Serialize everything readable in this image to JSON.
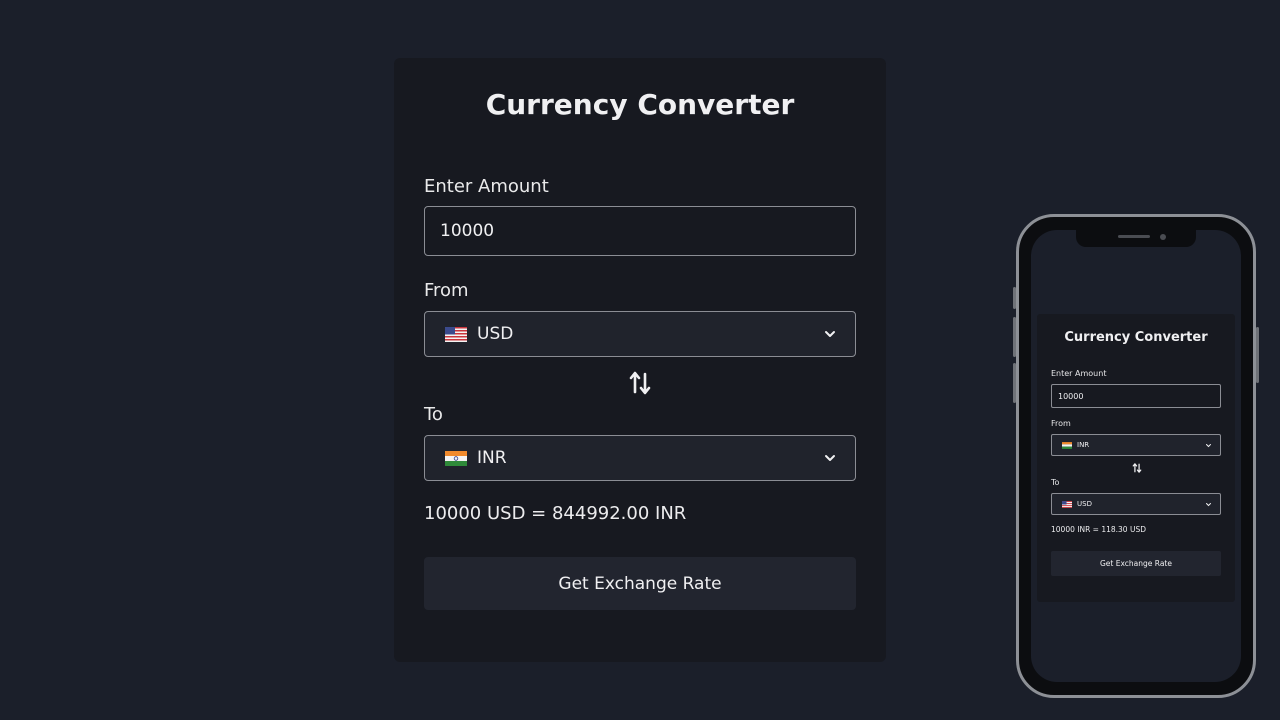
{
  "converter": {
    "title": "Currency Converter",
    "amount_label": "Enter Amount",
    "amount_value": "10000",
    "from_label": "From",
    "from_currency": {
      "code": "USD",
      "flag": "us-flag-icon"
    },
    "to_label": "To",
    "to_currency": {
      "code": "INR",
      "flag": "india-flag-icon"
    },
    "result": "10000 USD = 844992.00 INR",
    "button_label": "Get Exchange Rate"
  },
  "mobile_preview": {
    "title": "Currency Converter",
    "amount_label": "Enter Amount",
    "amount_value": "10000",
    "from_label": "From",
    "from_currency": {
      "code": "INR",
      "flag": "india-flag-icon"
    },
    "to_label": "To",
    "to_currency": {
      "code": "USD",
      "flag": "us-flag-icon"
    },
    "result": "10000 INR = 118.30 USD",
    "button_label": "Get Exchange Rate"
  },
  "colors": {
    "background": "#1b1f2a",
    "card": "#171920",
    "button": "#22252f",
    "border": "#8b8d94"
  }
}
